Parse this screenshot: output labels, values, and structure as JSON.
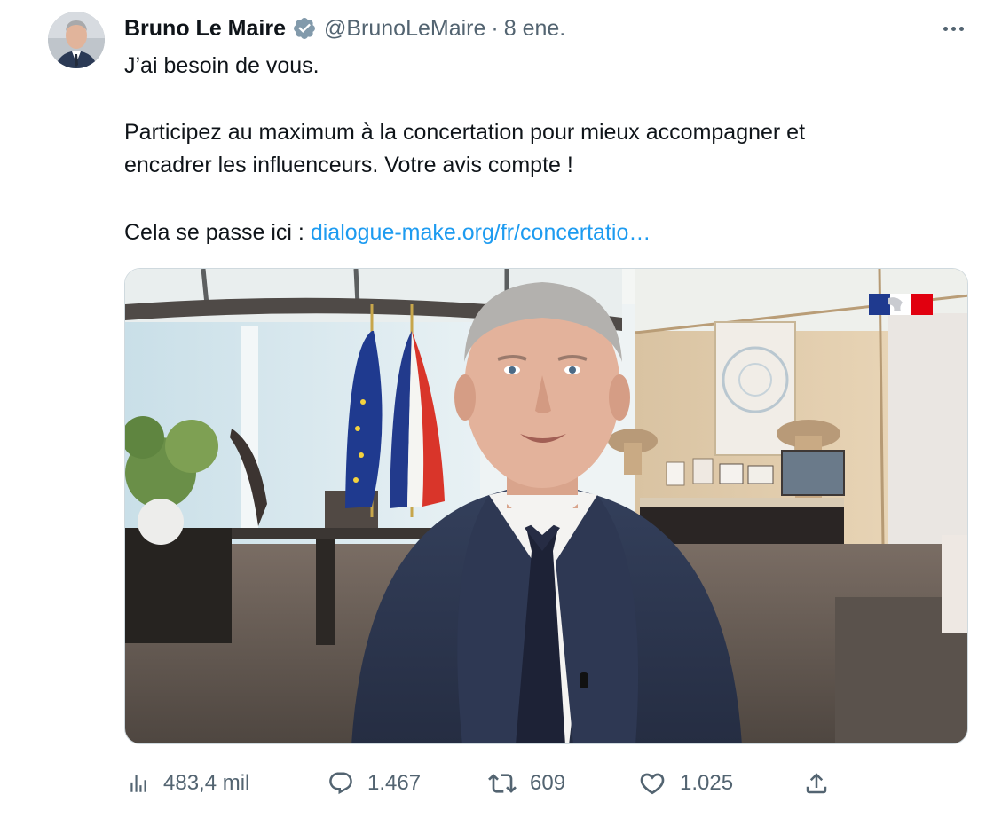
{
  "tweet": {
    "author_name": "Bruno Le Maire",
    "handle": "@BrunoLeMaire",
    "separator": "·",
    "time": "8 ene.",
    "lines": {
      "l1": "J’ai besoin de vous.",
      "l2": "Participez au maximum à la concertation pour mieux accompagner et",
      "l3": "encadrer les influenceurs. Votre avis compte !",
      "l4_prefix": "Cela se passe ici : ",
      "l4_link": "dialogue-make.org/fr/concertatio…"
    },
    "stats": {
      "views": "483,4 mil",
      "replies": "1.467",
      "retweets": "609",
      "likes": "1.025"
    }
  },
  "icons": {
    "verified": "verified-badge-icon",
    "more": "more-horizontal-icon",
    "views": "bar-chart-icon",
    "reply": "speech-bubble-icon",
    "retweet": "retweet-arrows-icon",
    "like": "heart-icon",
    "share": "share-upload-icon"
  },
  "colors": {
    "text": "#0f1419",
    "secondary": "#536471",
    "link": "#1d9bf0",
    "verified_badge": "#829aab",
    "border": "#cfd9de"
  }
}
